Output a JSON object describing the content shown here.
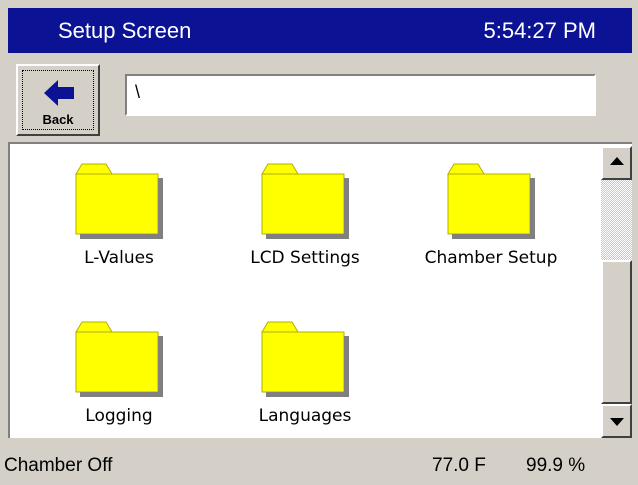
{
  "window": {
    "title": "Setup Screen",
    "clock": "5:54:27 PM",
    "title_bar_color": "#0b1394"
  },
  "toolbar": {
    "back_label": "Back",
    "back_icon": "left-arrow-icon",
    "path_value": "\\"
  },
  "items": [
    {
      "label": "L-Values",
      "icon": "folder-icon"
    },
    {
      "label": "LCD Settings",
      "icon": "folder-icon"
    },
    {
      "label": "Chamber Setup",
      "icon": "folder-icon"
    },
    {
      "label": "Logging",
      "icon": "folder-icon"
    },
    {
      "label": "Languages",
      "icon": "folder-icon"
    }
  ],
  "folder_color": "#ffff00",
  "status": {
    "text": "Chamber Off",
    "temperature": "77.0 F",
    "humidity": "99.9 %"
  }
}
